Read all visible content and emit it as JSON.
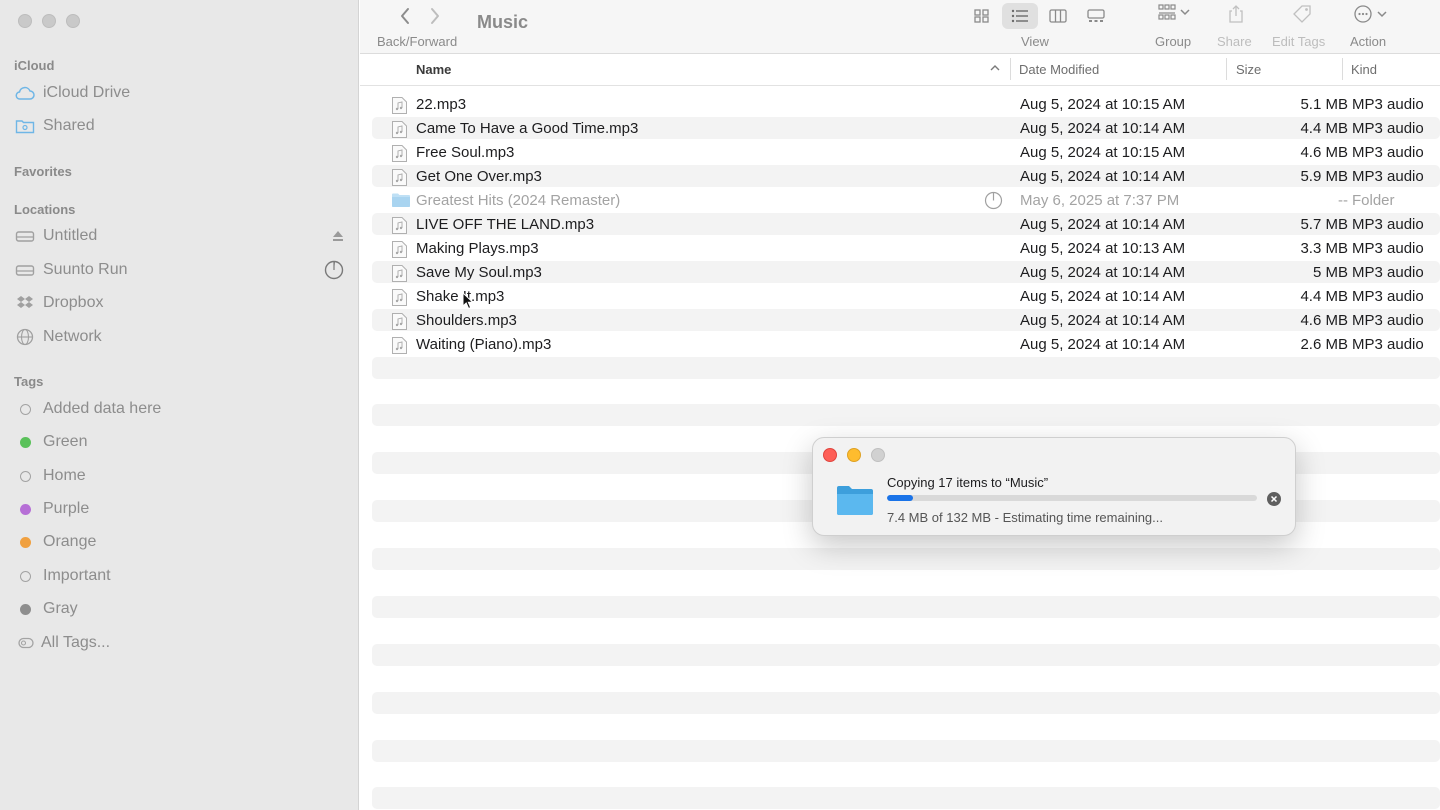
{
  "sidebar": {
    "sections": {
      "icloud": "iCloud",
      "favorites": "Favorites",
      "locations": "Locations",
      "tags": "Tags"
    },
    "icloud_items": [
      {
        "label": "iCloud Drive",
        "icon": "cloud-icon"
      },
      {
        "label": "Shared",
        "icon": "shared-folder-icon"
      }
    ],
    "location_items": [
      {
        "label": "Untitled",
        "icon": "drive-icon"
      },
      {
        "label": "Suunto Run",
        "icon": "drive-icon"
      },
      {
        "label": "Dropbox",
        "icon": "dropbox-icon"
      },
      {
        "label": "Network",
        "icon": "network-icon"
      }
    ],
    "tag_items": [
      {
        "label": "Added data here",
        "color": ""
      },
      {
        "label": "Green",
        "color": "#5ac15a"
      },
      {
        "label": "Home",
        "color": ""
      },
      {
        "label": "Purple",
        "color": "#b66fd6"
      },
      {
        "label": "Orange",
        "color": "#f0a040"
      },
      {
        "label": "Important",
        "color": ""
      },
      {
        "label": "Gray",
        "color": "#8e8e8e"
      },
      {
        "label": "All Tags...",
        "color": ""
      }
    ]
  },
  "toolbar": {
    "back_forward_label": "Back/Forward",
    "title": "Music",
    "view_label": "View",
    "group_label": "Group",
    "share_label": "Share",
    "edit_tags_label": "Edit Tags",
    "action_label": "Action"
  },
  "columns": {
    "name": "Name",
    "date_modified": "Date Modified",
    "size": "Size",
    "kind": "Kind"
  },
  "files": [
    {
      "name": "22.mp3",
      "date": "Aug 5, 2024 at 10:15 AM",
      "size": "5.1 MB",
      "kind": "MP3 audio"
    },
    {
      "name": "Came To Have a Good Time.mp3",
      "date": "Aug 5, 2024 at 10:14 AM",
      "size": "4.4 MB",
      "kind": "MP3 audio"
    },
    {
      "name": "Free Soul.mp3",
      "date": "Aug 5, 2024 at 10:15 AM",
      "size": "4.6 MB",
      "kind": "MP3 audio"
    },
    {
      "name": "Get One Over.mp3",
      "date": "Aug 5, 2024 at 10:14 AM",
      "size": "5.9 MB",
      "kind": "MP3 audio"
    },
    {
      "name": "Greatest Hits (2024 Remaster)",
      "date": "May 6, 2025 at 7:37 PM",
      "size": "--",
      "kind": "Folder"
    },
    {
      "name": "LIVE OFF THE LAND.mp3",
      "date": "Aug 5, 2024 at 10:14 AM",
      "size": "5.7 MB",
      "kind": "MP3 audio"
    },
    {
      "name": "Making Plays.mp3",
      "date": "Aug 5, 2024 at 10:13 AM",
      "size": "3.3 MB",
      "kind": "MP3 audio"
    },
    {
      "name": "Save My Soul.mp3",
      "date": "Aug 5, 2024 at 10:14 AM",
      "size": "5 MB",
      "kind": "MP3 audio"
    },
    {
      "name": "Shake It.mp3",
      "date": "Aug 5, 2024 at 10:14 AM",
      "size": "4.4 MB",
      "kind": "MP3 audio"
    },
    {
      "name": "Shoulders.mp3",
      "date": "Aug 5, 2024 at 10:14 AM",
      "size": "4.6 MB",
      "kind": "MP3 audio"
    },
    {
      "name": "Waiting (Piano).mp3",
      "date": "Aug 5, 2024 at 10:14 AM",
      "size": "2.6 MB",
      "kind": "MP3 audio"
    }
  ],
  "copy_dialog": {
    "title": "Copying 17 items to “Music”",
    "status": "7.4 MB of 132 MB - Estimating time remaining...",
    "progress_fraction": 0.056
  },
  "colors": {
    "progress": "#1a73e8",
    "folder": "#4fb3ea"
  }
}
